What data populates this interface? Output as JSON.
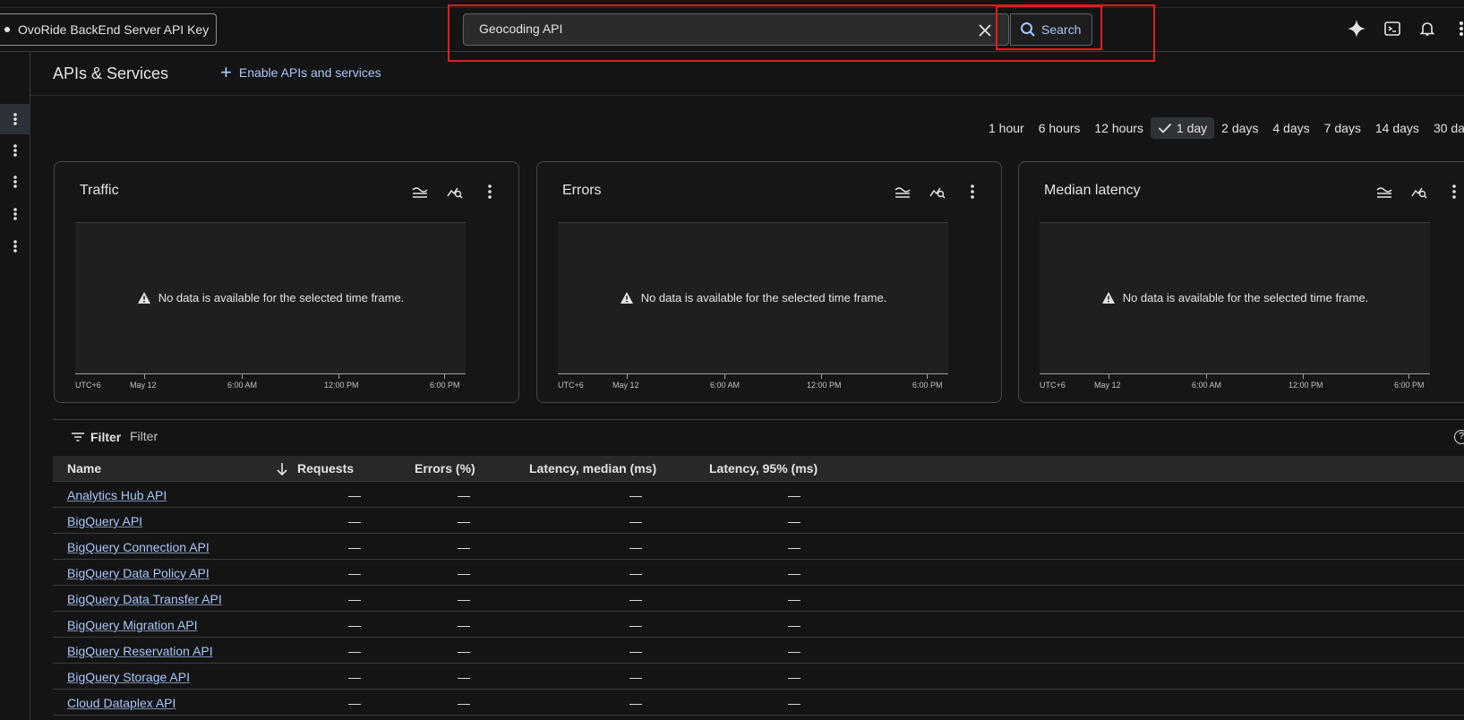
{
  "topbar": {
    "project_label": "OvoRide BackEnd Server API Key",
    "search_value": "Geocoding API",
    "search_button_label": "Search"
  },
  "header": {
    "title": "APIs & Services",
    "enable_label": "Enable APIs and services"
  },
  "time_ranges": [
    "1 hour",
    "6 hours",
    "12 hours",
    "1 day",
    "2 days",
    "4 days",
    "7 days",
    "14 days",
    "30 da"
  ],
  "selected_range": "1 day",
  "cards": [
    {
      "title": "Traffic",
      "no_data": "No data is available for the selected time frame."
    },
    {
      "title": "Errors",
      "no_data": "No data is available for the selected time frame."
    },
    {
      "title": "Median latency",
      "no_data": "No data is available for the selected time frame."
    }
  ],
  "axis_labels": [
    "UTC+6",
    "May 12",
    "6:00 AM",
    "12:00 PM",
    "6:00 PM"
  ],
  "filter": {
    "button_label": "Filter",
    "placeholder": "Filter"
  },
  "table": {
    "headers": {
      "name": "Name",
      "requests": "Requests",
      "errors": "Errors (%)",
      "latency_median": "Latency, median (ms)",
      "latency_95": "Latency, 95% (ms)"
    },
    "rows": [
      {
        "name": "Analytics Hub API",
        "requests": "—",
        "errors": "—",
        "latency_median": "—",
        "latency_95": "—"
      },
      {
        "name": "BigQuery API",
        "requests": "—",
        "errors": "—",
        "latency_median": "—",
        "latency_95": "—"
      },
      {
        "name": "BigQuery Connection API",
        "requests": "—",
        "errors": "—",
        "latency_median": "—",
        "latency_95": "—"
      },
      {
        "name": "BigQuery Data Policy API",
        "requests": "—",
        "errors": "—",
        "latency_median": "—",
        "latency_95": "—"
      },
      {
        "name": "BigQuery Data Transfer API",
        "requests": "—",
        "errors": "—",
        "latency_median": "—",
        "latency_95": "—"
      },
      {
        "name": "BigQuery Migration API",
        "requests": "—",
        "errors": "—",
        "latency_median": "—",
        "latency_95": "—"
      },
      {
        "name": "BigQuery Reservation API",
        "requests": "—",
        "errors": "—",
        "latency_median": "—",
        "latency_95": "—"
      },
      {
        "name": "BigQuery Storage API",
        "requests": "—",
        "errors": "—",
        "latency_median": "—",
        "latency_95": "—"
      },
      {
        "name": "Cloud Dataplex API",
        "requests": "—",
        "errors": "—",
        "latency_median": "—",
        "latency_95": "—"
      }
    ]
  },
  "colors": {
    "accent": "#a8c7fa",
    "highlight": "#e81c1c",
    "background": "#141414"
  }
}
